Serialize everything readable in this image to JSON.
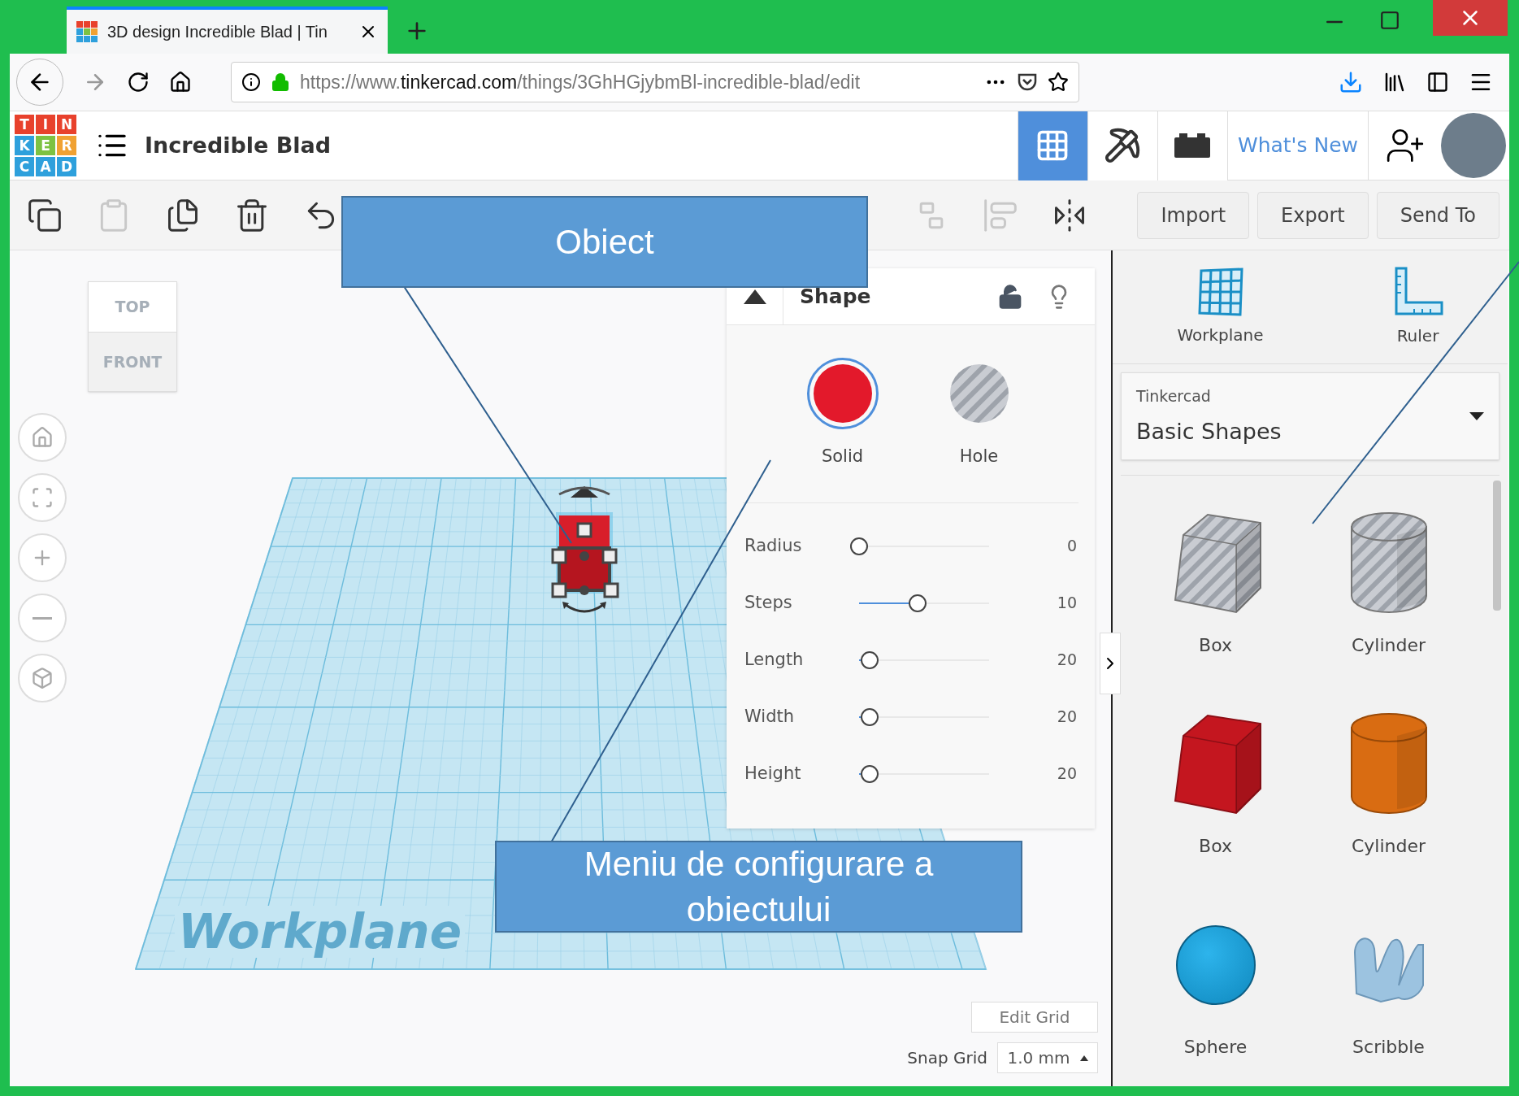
{
  "browser": {
    "tab": {
      "title": "3D design Incredible Blad | Tin"
    },
    "url": {
      "prefix": "https://www.",
      "domain": "tinkercad.com",
      "path": "/things/3GhHGjybmBl-incredible-blad/edit"
    }
  },
  "app_header": {
    "logo_letters": [
      "T",
      "I",
      "N",
      "K",
      "E",
      "R",
      "C",
      "A",
      "D"
    ],
    "design_name": "Incredible Blad",
    "views": [
      {
        "kind": "grid",
        "selected": true
      },
      {
        "kind": "pickaxe",
        "selected": false
      },
      {
        "kind": "bricks",
        "selected": false
      }
    ],
    "whats_new": "What's New"
  },
  "toolbar": {
    "tools": [
      {
        "kind": "copy",
        "disabled": false
      },
      {
        "kind": "paste",
        "disabled": true
      },
      {
        "kind": "duplicate",
        "disabled": false
      },
      {
        "kind": "delete",
        "disabled": false
      },
      {
        "kind": "undo",
        "disabled": false
      },
      {
        "kind": "ungroup",
        "disabled": true
      },
      {
        "kind": "align",
        "disabled": true
      },
      {
        "kind": "mirror",
        "disabled": false
      }
    ],
    "buttons": [
      "Import",
      "Export",
      "Send To"
    ]
  },
  "view_cube": {
    "top": "TOP",
    "front": "FRONT"
  },
  "workplane_label": "Workplane",
  "shape_panel": {
    "title": "Shape",
    "types": [
      {
        "label": "Solid",
        "kind": "solid",
        "selected": true
      },
      {
        "label": "Hole",
        "kind": "hole",
        "selected": false
      }
    ],
    "params": [
      {
        "label": "Radius",
        "level": 0,
        "value": "0"
      },
      {
        "label": "Steps",
        "level": 0.45,
        "value": "10"
      },
      {
        "label": "Length",
        "level": 0.08,
        "value": "20"
      },
      {
        "label": "Width",
        "level": 0.08,
        "value": "20"
      },
      {
        "label": "Height",
        "level": 0.08,
        "value": "20"
      }
    ]
  },
  "grid_controls": {
    "edit_grid": "Edit Grid",
    "snap_label": "Snap Grid",
    "snap_value": "1.0 mm"
  },
  "side_panel": {
    "tools": [
      {
        "kind": "workplane",
        "label": "Workplane"
      },
      {
        "kind": "ruler",
        "label": "Ruler"
      }
    ],
    "library": {
      "source": "Tinkercad",
      "category": "Basic Shapes"
    },
    "shapes": [
      {
        "kind": "box",
        "hole": true,
        "label": "Box"
      },
      {
        "kind": "cylinder",
        "hole": true,
        "label": "Cylinder"
      },
      {
        "kind": "box",
        "hole": false,
        "color": "#c4161f",
        "label": "Box"
      },
      {
        "kind": "cylinder",
        "hole": false,
        "color": "#d96c12",
        "label": "Cylinder"
      },
      {
        "kind": "sphere",
        "hole": false,
        "color": "#1591c7",
        "label": "Sphere"
      },
      {
        "kind": "scribble",
        "hole": false,
        "color": "#9cc3e0",
        "label": "Scribble"
      }
    ]
  },
  "annotations": [
    {
      "text": "Obiect"
    },
    {
      "text": "Meniu de configurare a obiectului"
    }
  ]
}
